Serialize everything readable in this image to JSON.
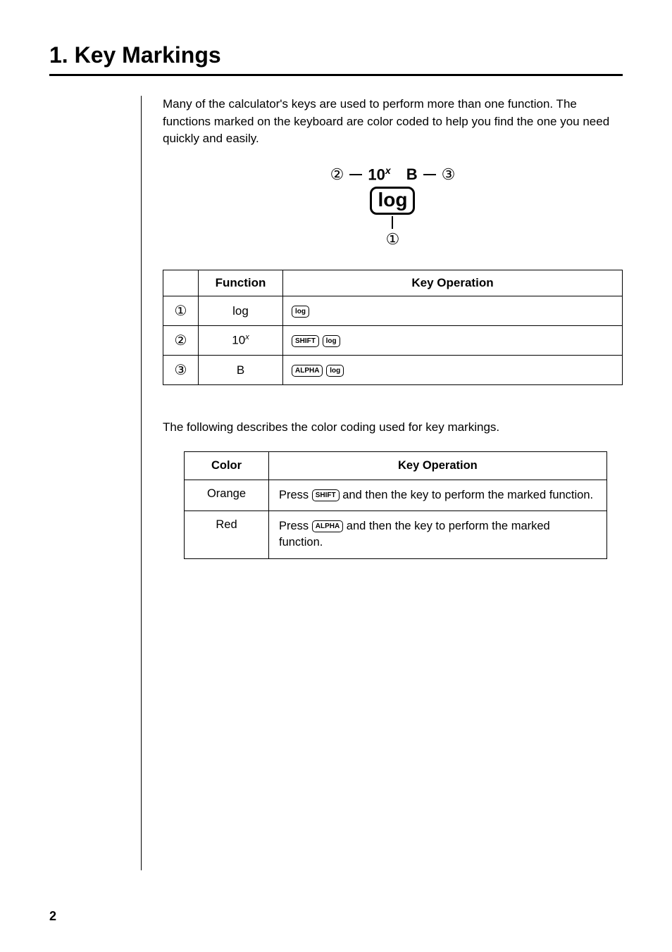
{
  "title": "1. Key Markings",
  "intro": "Many of the calculator's keys are used to perform more than one function. The functions marked on the keyboard are color coded to help you find the one you need quickly and easily.",
  "diagram": {
    "num2": "②",
    "num3": "③",
    "num1": "①",
    "tenx_html": "10<sup class='ital'>x</sup>",
    "b": "B",
    "log": "log"
  },
  "func_table": {
    "headers": {
      "blank": "",
      "function": "Function",
      "operation": "Key Operation"
    },
    "rows": [
      {
        "num": "①",
        "func": "log",
        "keys": [
          "log"
        ]
      },
      {
        "num": "②",
        "func_html": "10<sup class='italic-x'>x</sup>",
        "keys": [
          "SHIFT",
          "log"
        ]
      },
      {
        "num": "③",
        "func": "B",
        "keys": [
          "ALPHA",
          "log"
        ]
      }
    ]
  },
  "follow_text": "The following describes the color coding used for key markings.",
  "color_table": {
    "headers": {
      "color": "Color",
      "operation": "Key Operation"
    },
    "rows": [
      {
        "color": "Orange",
        "key": "SHIFT",
        "desc_before": "Press ",
        "desc_after": " and then the key to perform the marked function."
      },
      {
        "color": "Red",
        "key": "ALPHA",
        "desc_before": "Press ",
        "desc_after": " and then the key to perform the marked function."
      }
    ]
  },
  "page_number": "2"
}
